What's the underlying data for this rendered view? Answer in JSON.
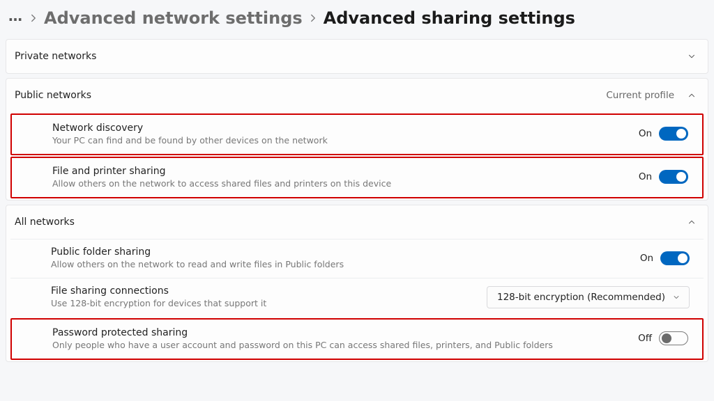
{
  "breadcrumb": {
    "back_level": "Advanced network settings",
    "current_page": "Advanced sharing settings"
  },
  "sections": {
    "private": {
      "title": "Private networks",
      "expanded": false
    },
    "public": {
      "title": "Public networks",
      "badge": "Current profile",
      "expanded": true,
      "network_discovery": {
        "label": "Network discovery",
        "desc": "Your PC can find and be found by other devices on the network",
        "state_label": "On",
        "on": true
      },
      "file_printer_sharing": {
        "label": "File and printer sharing",
        "desc": "Allow others on the network to access shared files and printers on this device",
        "state_label": "On",
        "on": true
      }
    },
    "all": {
      "title": "All networks",
      "expanded": true,
      "public_folder_sharing": {
        "label": "Public folder sharing",
        "desc": "Allow others on the network to read and write files in Public folders",
        "state_label": "On",
        "on": true
      },
      "file_sharing_connections": {
        "label": "File sharing connections",
        "desc": "Use 128-bit encryption for devices that support it",
        "dropdown_selected": "128-bit encryption (Recommended)"
      },
      "password_protected_sharing": {
        "label": "Password protected sharing",
        "desc": "Only people who have a user account and password on this PC can access shared files, printers, and Public folders",
        "state_label": "Off",
        "on": false
      }
    }
  }
}
